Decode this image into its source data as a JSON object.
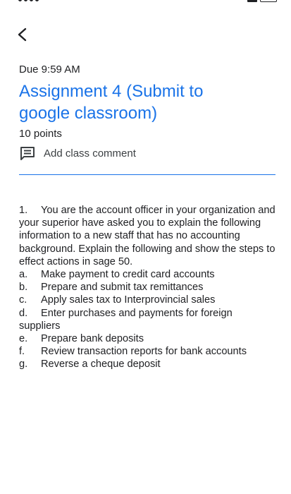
{
  "header": {
    "back_icon": "chevron-left-icon"
  },
  "assignment": {
    "due": "Due 9:59 AM",
    "title": "Assignment 4 (Submit to google classroom)",
    "points": "10 points",
    "comment_icon": "comment-icon",
    "comment_label": "Add class comment"
  },
  "instructions": {
    "question_number": "1.",
    "question_text": "You are the account officer in your organization and your superior have asked you to explain the following information to a new staff that has no accounting background. Explain the following and show the steps to effect actions in sage 50.",
    "items": [
      {
        "marker": "a.",
        "text": "Make payment to credit card accounts"
      },
      {
        "marker": "b.",
        "text": "Prepare and submit tax remittances"
      },
      {
        "marker": "c.",
        "text": "Apply sales tax to Interprovincial sales"
      },
      {
        "marker": "d.",
        "text": "Enter purchases and payments for foreign suppliers"
      },
      {
        "marker": "e.",
        "text": "Prepare bank deposits"
      },
      {
        "marker": "f.",
        "text": "Review transaction reports for bank accounts"
      },
      {
        "marker": "g.",
        "text": "Reverse a cheque deposit"
      }
    ]
  },
  "colors": {
    "accent": "#1a73e8",
    "text": "#202124"
  }
}
